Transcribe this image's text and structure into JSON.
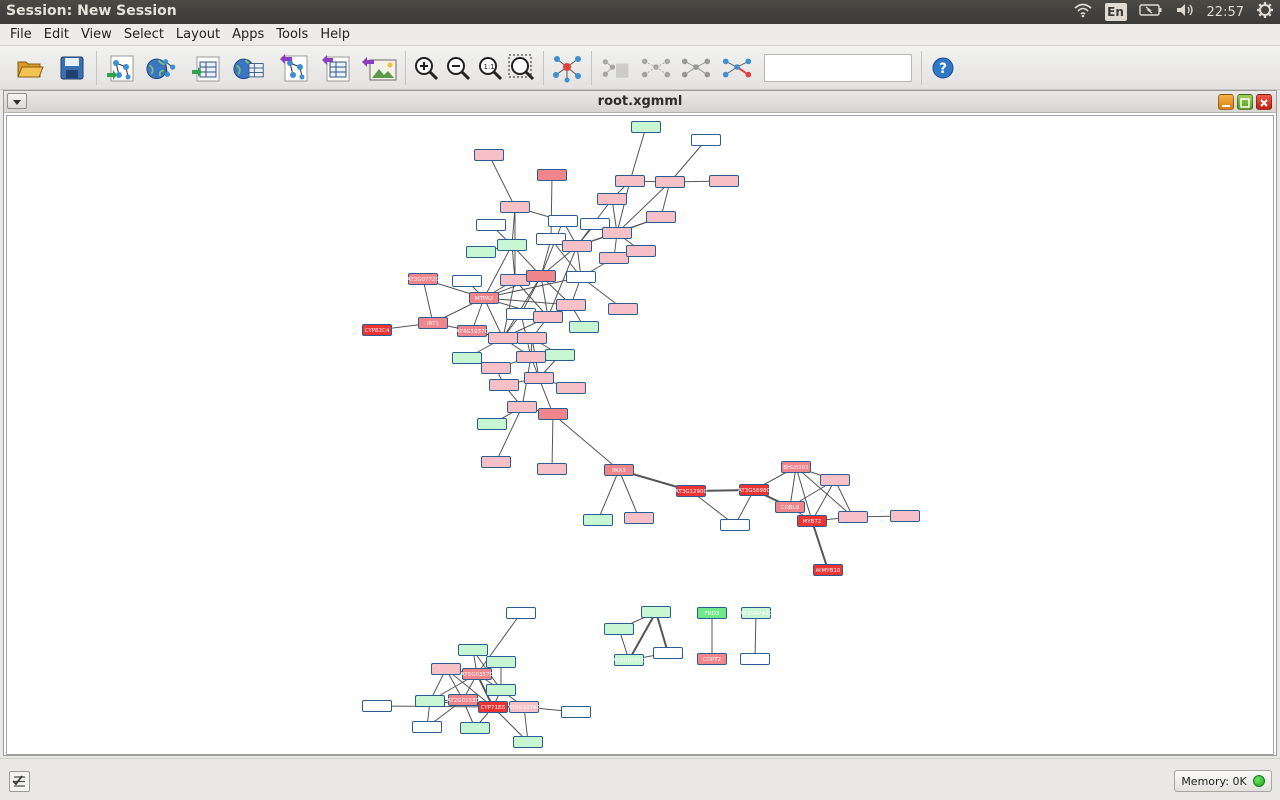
{
  "top_panel": {
    "title": "Session: New Session",
    "keyboard": "En",
    "time": "22:57",
    "icons": [
      "wifi-icon",
      "battery-icon",
      "volume-icon",
      "power-gear-icon"
    ]
  },
  "menubar": {
    "items": [
      {
        "label": "File"
      },
      {
        "label": "Edit"
      },
      {
        "label": "View"
      },
      {
        "label": "Select"
      },
      {
        "label": "Layout"
      },
      {
        "label": "Apps"
      },
      {
        "label": "Tools"
      },
      {
        "label": "Help"
      }
    ]
  },
  "toolbar": {
    "buttons": [
      "open-session-icon",
      "save-session-icon",
      "import-network-file-icon",
      "import-network-web-icon",
      "import-table-file-icon",
      "import-table-web-icon",
      "export-network-icon",
      "export-table-icon",
      "export-image-icon",
      "zoom-in-icon",
      "zoom-out-icon",
      "zoom-fit-icon",
      "zoom-selected-icon",
      "apply-layout-icon",
      "new-network-from-selection-icon",
      "new-network-all-edges-icon",
      "new-network-clone-icon",
      "new-network-selected-edges-icon",
      "help-icon"
    ],
    "search_value": ""
  },
  "frame": {
    "title": "root.xgmml"
  },
  "graph": {
    "colors": {
      "edge": "#555555",
      "red_fill": "#ee3333",
      "pink_fill": "#f7c0c6",
      "mid_fill": "#f0858c",
      "green_fill": "#c8f5d2",
      "bright_green_fill": "#6fe88a",
      "white_fill": "#ffffff",
      "node_border": "#2a5d93"
    },
    "labeled_nodes": [
      {
        "label": "AT3G07720"
      },
      {
        "label": "MTPA2"
      },
      {
        "label": "CYP82C4"
      },
      {
        "label": "IRT1"
      },
      {
        "label": "AT4G19370"
      },
      {
        "label": "AT3G12900"
      },
      {
        "label": "AT3G56980"
      },
      {
        "label": "BHLH101"
      },
      {
        "label": "COBL6"
      },
      {
        "label": "MYB72"
      },
      {
        "label": "AtMYB10"
      },
      {
        "label": "IMA3"
      },
      {
        "label": "COPT2"
      },
      {
        "label": "AT5G03570"
      },
      {
        "label": "CYP71B5"
      },
      {
        "label": "AT2G01530"
      },
      {
        "label": "AT5G13740"
      },
      {
        "label": "AT1G07610"
      },
      {
        "label": "FRD3"
      },
      {
        "label": "AT1G47400"
      }
    ]
  },
  "statusbar": {
    "memory_label": "Memory: 0K"
  }
}
